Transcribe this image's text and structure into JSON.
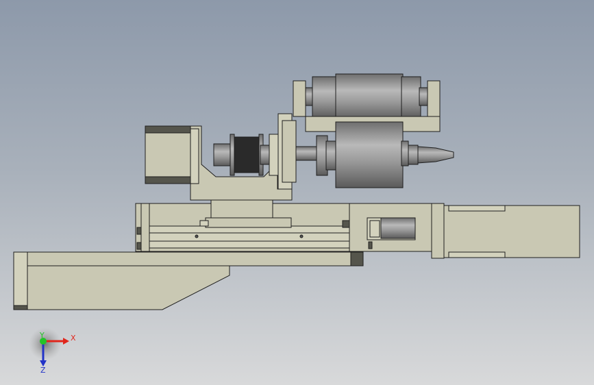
{
  "triad": {
    "x_label": "X",
    "y_label": "Y",
    "z_label": "Z",
    "x_color": "#e0261c",
    "y_color": "#22c427",
    "z_color": "#2233c8"
  },
  "colors": {
    "background_top": "#8d99aa",
    "background_bottom": "#d8d9da",
    "part_fill": "#c9c8b3",
    "metal": "#8a8a8a"
  }
}
